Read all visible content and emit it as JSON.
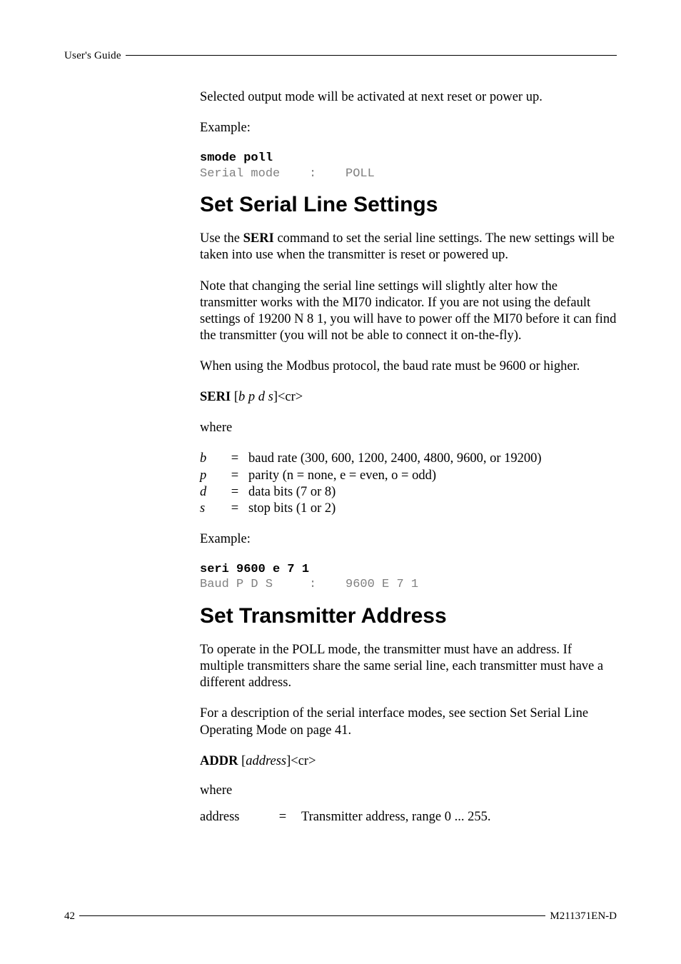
{
  "running_head": "User's Guide",
  "intro": {
    "para": "Selected output mode will be activated at next reset or power up.",
    "example_label": "Example:",
    "code_user": "smode poll",
    "code_out": "Serial mode    :    POLL"
  },
  "seri": {
    "heading": "Set Serial Line Settings",
    "p1_a": "Use the ",
    "p1_cmd": "SERI",
    "p1_b": " command to set the serial line settings. The new settings will be taken into use when the transmitter is reset or powered up.",
    "p2": "Note that changing the serial line settings will slightly alter how the transmitter works with the MI70 indicator. If you are not using the default settings of 19200 N 8 1, you will have to power off the MI70 before it can find the transmitter (you will not be able to connect it on-the-fly).",
    "p3": "When using the Modbus protocol, the baud rate must be 9600 or higher.",
    "syntax_cmd": "SERI",
    "syntax_args": "b p d s",
    "syntax_tail": "]<cr>",
    "where": "where",
    "params": [
      {
        "var": "b",
        "desc": "baud rate (300, 600, 1200, 2400, 4800, 9600, or 19200)"
      },
      {
        "var": "p",
        "desc": "parity (n = none, e = even, o = odd)"
      },
      {
        "var": "d",
        "desc": "data bits (7 or 8)"
      },
      {
        "var": "s",
        "desc": "stop bits (1 or 2)"
      }
    ],
    "example_label": "Example:",
    "code_user": "seri 9600 e 7 1",
    "code_out": "Baud P D S     :    9600 E 7 1"
  },
  "addr": {
    "heading": "Set Transmitter Address",
    "p1": "To operate in the POLL mode, the transmitter must have an address. If multiple transmitters share the same serial line, each transmitter must have a different address.",
    "p2": "For a description of the serial interface modes, see section Set Serial Line Operating Mode on page 41.",
    "syntax_cmd": "ADDR",
    "syntax_arg": "address",
    "syntax_tail": "]<cr>",
    "where": "where",
    "param_var": "address",
    "param_desc": "Transmitter address, range 0 ... 255."
  },
  "footer": {
    "page": "42",
    "docid": "M211371EN-D"
  }
}
